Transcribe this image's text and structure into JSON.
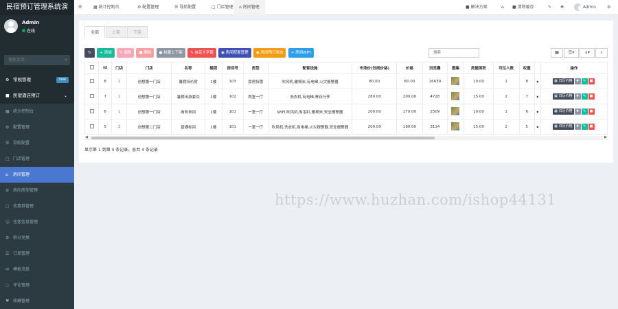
{
  "app": {
    "title": "民宿预订管理系统演"
  },
  "user": {
    "name": "Admin",
    "status": "在线"
  },
  "search": {
    "placeholder": "搜索菜单"
  },
  "sidebar": {
    "items": [
      {
        "label": "常规管理",
        "badge": "new"
      },
      {
        "label": "民宿酒店预订"
      },
      {
        "label": "统计控制台"
      },
      {
        "label": "配置管理"
      },
      {
        "label": "导航配置"
      },
      {
        "label": "门店管理"
      },
      {
        "label": "房间管理"
      },
      {
        "label": "房间房型管理"
      },
      {
        "label": "优惠券管理"
      },
      {
        "label": "住客信息管理"
      },
      {
        "label": "积分兑换"
      },
      {
        "label": "订单管理"
      },
      {
        "label": "模板消息"
      },
      {
        "label": "评论管理"
      },
      {
        "label": "收藏管理"
      }
    ]
  },
  "topbar": {
    "tabs": [
      "统计控制台",
      "配置管理",
      "导航配置",
      "门店管理",
      "房间管理"
    ],
    "right": {
      "solution": "解决方案",
      "clear_cache": "清除缓存",
      "user": "Admin"
    }
  },
  "panel": {
    "tabs": [
      "全部",
      "上架",
      "下架"
    ],
    "buttons": {
      "refresh": "",
      "add": "添加",
      "edit": "编辑",
      "delete": "删除",
      "batch": "批量上下架",
      "custom": "自定义字段",
      "room_config": "房间配置管理",
      "room_booking": "房间预订状态",
      "wifi": "房间WIFI"
    },
    "search_placeholder": "搜索",
    "columns": [
      "Id",
      "门店",
      "门店",
      "名称",
      "楼层",
      "房间号",
      "房型",
      "配套设施",
      "市场价(划线价格)",
      "价格",
      "浏览量",
      "图集",
      "房屋面积",
      "可住人数",
      "权重",
      "操作"
    ],
    "rows": [
      {
        "id": "8",
        "store_id": "1",
        "store": "创想第一门店",
        "name": "暑假特价房",
        "floor": "1楼",
        "room": "103",
        "type": "豪房特惠",
        "facilities": "吹风机,暖椅米,有电梯,火灾报警器",
        "market_price": "80.00",
        "price": "60.00",
        "views": "16639",
        "area": "10.00",
        "capacity": "1",
        "weight": "8"
      },
      {
        "id": "7",
        "store_id": "1",
        "store": "创想第一门店",
        "name": "暑假出游套间",
        "floor": "1楼",
        "room": "102",
        "type": "两室一厅",
        "facilities": "洗衣机,有电梯,寄存行李",
        "market_price": "280.00",
        "price": "200.00",
        "views": "4728",
        "area": "15.00",
        "capacity": "2",
        "weight": "7"
      },
      {
        "id": "6",
        "store_id": "1",
        "store": "创想第一门店",
        "name": "商务单间",
        "floor": "1楼",
        "room": "101",
        "type": "一室一厅",
        "facilities": "WIFI,吹风机,有浴缸,暖椅米,安全报警器",
        "market_price": "200.00",
        "price": "170.00",
        "views": "2509",
        "area": "10.00",
        "capacity": "1",
        "weight": "6"
      },
      {
        "id": "5",
        "store_id": "2",
        "store": "创想第二门店",
        "name": "普通标间",
        "floor": "1楼",
        "room": "101",
        "type": "一室一厅",
        "facilities": "吹风机,洗衣机,有电梯,火灾报警器,安全报警器",
        "market_price": "200.00",
        "price": "180.00",
        "views": "3114",
        "area": "15.00",
        "capacity": "2",
        "weight": "5"
      }
    ],
    "row_actions": {
      "dated_price": "日历价格"
    },
    "footer": "显示第 1 到第 4 条记录，总共 4 条记录"
  },
  "watermark": "https://www.huzhan.com/ishop44131"
}
